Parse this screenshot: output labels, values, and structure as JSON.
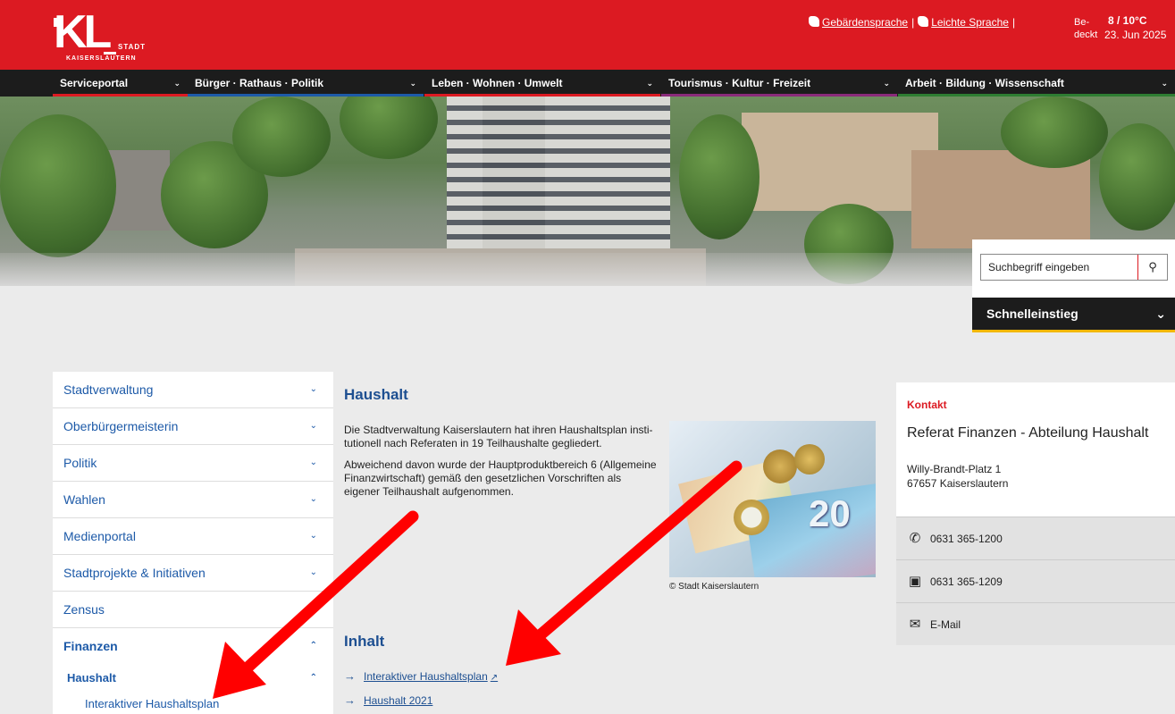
{
  "header": {
    "logo": {
      "letters": "KL",
      "stadt": "STADT",
      "city": "KAISERSLAUTERN"
    },
    "links": [
      {
        "label": "Gebärdensprache",
        "icon": "sign-language-icon"
      },
      {
        "label": "Leichte Sprache",
        "icon": "easy-language-icon"
      }
    ],
    "weather": {
      "condition": "Be-deckt",
      "temperature": "8 / 10°C",
      "date": "23. Jun 2025"
    }
  },
  "nav": {
    "items": [
      {
        "label": "Serviceportal",
        "color": "#dc1a22"
      },
      {
        "label": "Bürger · Rathaus · Politik",
        "color": "#1d5aa8"
      },
      {
        "label": "Leben · Wohnen · Umwelt",
        "color": "#dc1a22"
      },
      {
        "label": "Tourismus · Kultur · Freizeit",
        "color": "#8a2a7a"
      },
      {
        "label": "Arbeit · Bildung · Wissenschaft",
        "color": "#2e7d32"
      }
    ]
  },
  "search": {
    "placeholder": "Suchbegriff eingeben"
  },
  "quickaccess": {
    "label": "Schnelleinstieg"
  },
  "leftmenu": {
    "items": [
      {
        "label": "Stadtverwaltung"
      },
      {
        "label": "Oberbürgermeisterin"
      },
      {
        "label": "Politik"
      },
      {
        "label": "Wahlen"
      },
      {
        "label": "Medienportal"
      },
      {
        "label": "Stadtprojekte & Initiativen"
      },
      {
        "label": "Zensus"
      },
      {
        "label": "Finanzen"
      }
    ],
    "sub": {
      "label": "Haushalt"
    },
    "subsub": {
      "label": "Interaktiver Haushaltsplan"
    }
  },
  "main": {
    "title": "Haushalt",
    "paragraphs": [
      "Die Stadtverwaltung Kaiserslautern hat ihren Haushaltsplan insti-tutionell nach Referaten in 19 Teilhaushalte gegliedert.",
      "Abweichend davon wurde der Hauptproduktbereich 6 (Allgemeine Finanzwirtschaft) gemäß den gesetzlichen Vorschriften als eigener Teilhaushalt aufgenommen."
    ],
    "photo_credit": "© Stadt Kaiserslautern",
    "photo_note": "20",
    "contents_title": "Inhalt",
    "links": [
      {
        "label": "Interaktiver Haushaltsplan",
        "external": "↗"
      },
      {
        "label": "Haushalt 2021"
      }
    ]
  },
  "contact": {
    "label": "Kontakt",
    "org": "Referat Finanzen - Abteilung Haushalt",
    "street": "Willy-Brandt-Platz 1",
    "city": "67657 Kaiserslautern",
    "phone": "0631 365-1200",
    "fax": "0631 365-1209",
    "email": "E-Mail"
  },
  "colors": {
    "brand_red": "#dc1a22",
    "link_blue": "#1d5aa8",
    "accent_yellow": "#f2b705"
  }
}
